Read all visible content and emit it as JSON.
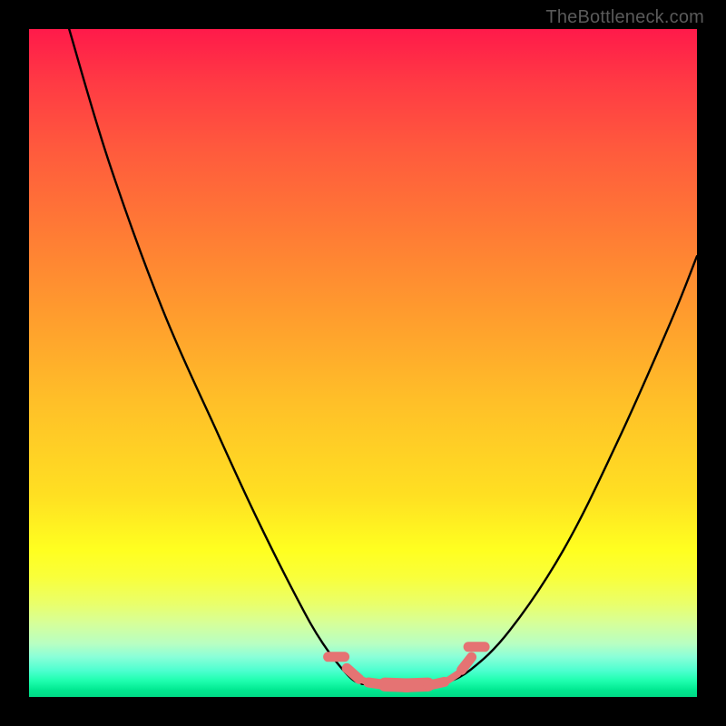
{
  "watermark": {
    "text": "TheBottleneck.com"
  },
  "colors": {
    "background": "#000000",
    "curve_stroke": "#000000",
    "marker_fill": "#e57373",
    "marker_stroke": "#d46a6a"
  },
  "chart_data": {
    "type": "line",
    "title": "",
    "xlabel": "",
    "ylabel": "",
    "xlim": [
      0,
      100
    ],
    "ylim": [
      0,
      100
    ],
    "grid": false,
    "legend": false,
    "series": [
      {
        "name": "left-curve",
        "x": [
          6,
          12,
          20,
          28,
          34,
          40,
          44,
          48,
          50
        ],
        "values": [
          100,
          80,
          58,
          40,
          27,
          15,
          8,
          3,
          2
        ]
      },
      {
        "name": "floor",
        "x": [
          50,
          54,
          58,
          62
        ],
        "values": [
          2,
          1.8,
          1.8,
          2
        ]
      },
      {
        "name": "right-curve",
        "x": [
          62,
          66,
          72,
          80,
          88,
          96,
          100
        ],
        "values": [
          2,
          4,
          10,
          22,
          38,
          56,
          66
        ]
      }
    ],
    "markers": {
      "x": [
        46,
        48.5,
        50,
        52,
        55,
        58,
        61,
        63.5,
        65.5,
        67
      ],
      "values": [
        6,
        3.5,
        2.5,
        2,
        1.8,
        1.8,
        2,
        3,
        5,
        7.5
      ],
      "size": [
        10,
        10,
        7,
        10,
        14,
        14,
        10,
        7,
        10,
        10
      ]
    }
  }
}
